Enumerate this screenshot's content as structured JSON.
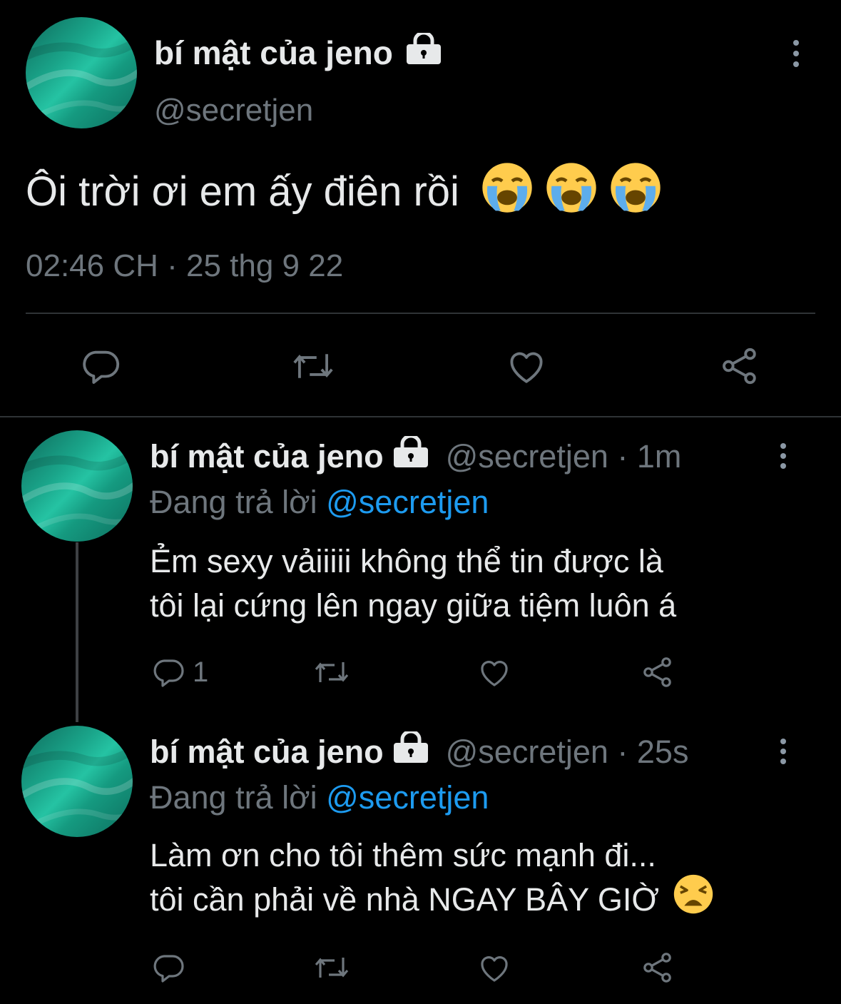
{
  "main_tweet": {
    "display_name": "bí mật của jeno",
    "handle": "@secretjen",
    "text": "Ôi trời ơi em ấy điên rồi",
    "emojis": [
      "loudly-crying-face",
      "loudly-crying-face",
      "loudly-crying-face"
    ],
    "timestamp": "02:46 CH · 25 thg 9 22",
    "actions": [
      "reply-icon",
      "retweet-icon",
      "like-icon",
      "share-icon"
    ]
  },
  "replies": [
    {
      "display_name": "bí mật của jeno",
      "handle": "@secretjen",
      "time": "1m",
      "replying_to_label": "Đang trả lời",
      "replying_to_handle": "@secretjen",
      "text_line1": "Ẻm sexy vảiiiii không thể tin được là",
      "text_line2": "tôi lại cứng lên ngay giữa tiệm luôn á",
      "reply_count": "1"
    },
    {
      "display_name": "bí mật của jeno",
      "handle": "@secretjen",
      "time": "25s",
      "replying_to_label": "Đang trả lời",
      "replying_to_handle": "@secretjen",
      "text_line1": "Làm ơn cho tôi thêm sức mạnh đi...",
      "text_line2": "tôi cần phải về nhà NGAY BÂY GIỜ",
      "emoji": "weary-face",
      "reply_count": ""
    }
  ],
  "colors": {
    "background": "#000000",
    "text": "#e7e9ea",
    "muted": "#6e767d",
    "mention": "#1d9bf0",
    "avatar": "#1aa58a"
  }
}
